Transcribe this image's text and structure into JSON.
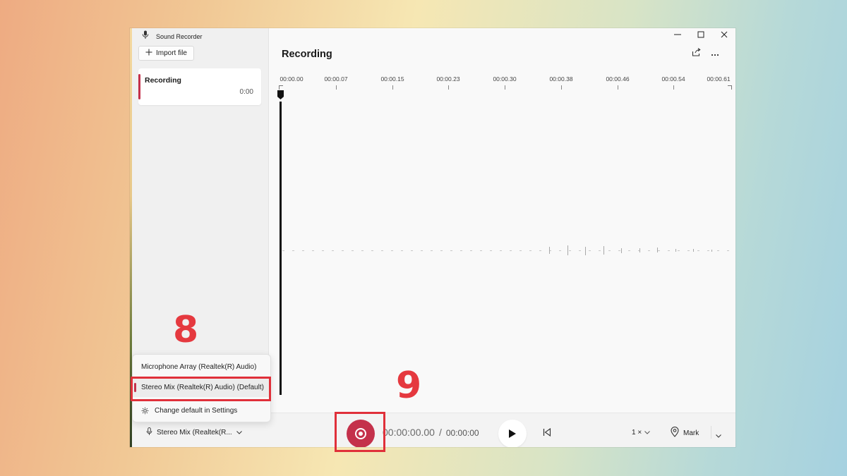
{
  "app": {
    "title": "Sound Recorder"
  },
  "sidebar": {
    "import_label": "Import file",
    "recordings": [
      {
        "name": "Recording",
        "duration": "0:00"
      }
    ]
  },
  "main": {
    "title": "Recording",
    "timeline_ticks": [
      "00:00.00",
      "00:00.07",
      "00:00.15",
      "00:00.23",
      "00:00.30",
      "00:00.38",
      "00:00.46",
      "00:00.54",
      "00:00.61"
    ]
  },
  "device_menu": {
    "items": [
      {
        "label": "Microphone Array (Realtek(R) Audio)",
        "selected": false
      },
      {
        "label": "Stereo Mix (Realtek(R) Audio) (Default)",
        "selected": true
      }
    ],
    "settings_label": "Change default in Settings"
  },
  "bottom": {
    "device_label": "Stereo Mix (Realtek(R...",
    "elapsed": "00:00:00.00",
    "separator": "/",
    "total": "00:00:00",
    "speed": "1 ×",
    "mark_label": "Mark"
  },
  "annotations": {
    "step_8": "8",
    "step_9": "9",
    "highlight_color": "#e0303a"
  },
  "colors": {
    "accent": "#c4314b"
  }
}
